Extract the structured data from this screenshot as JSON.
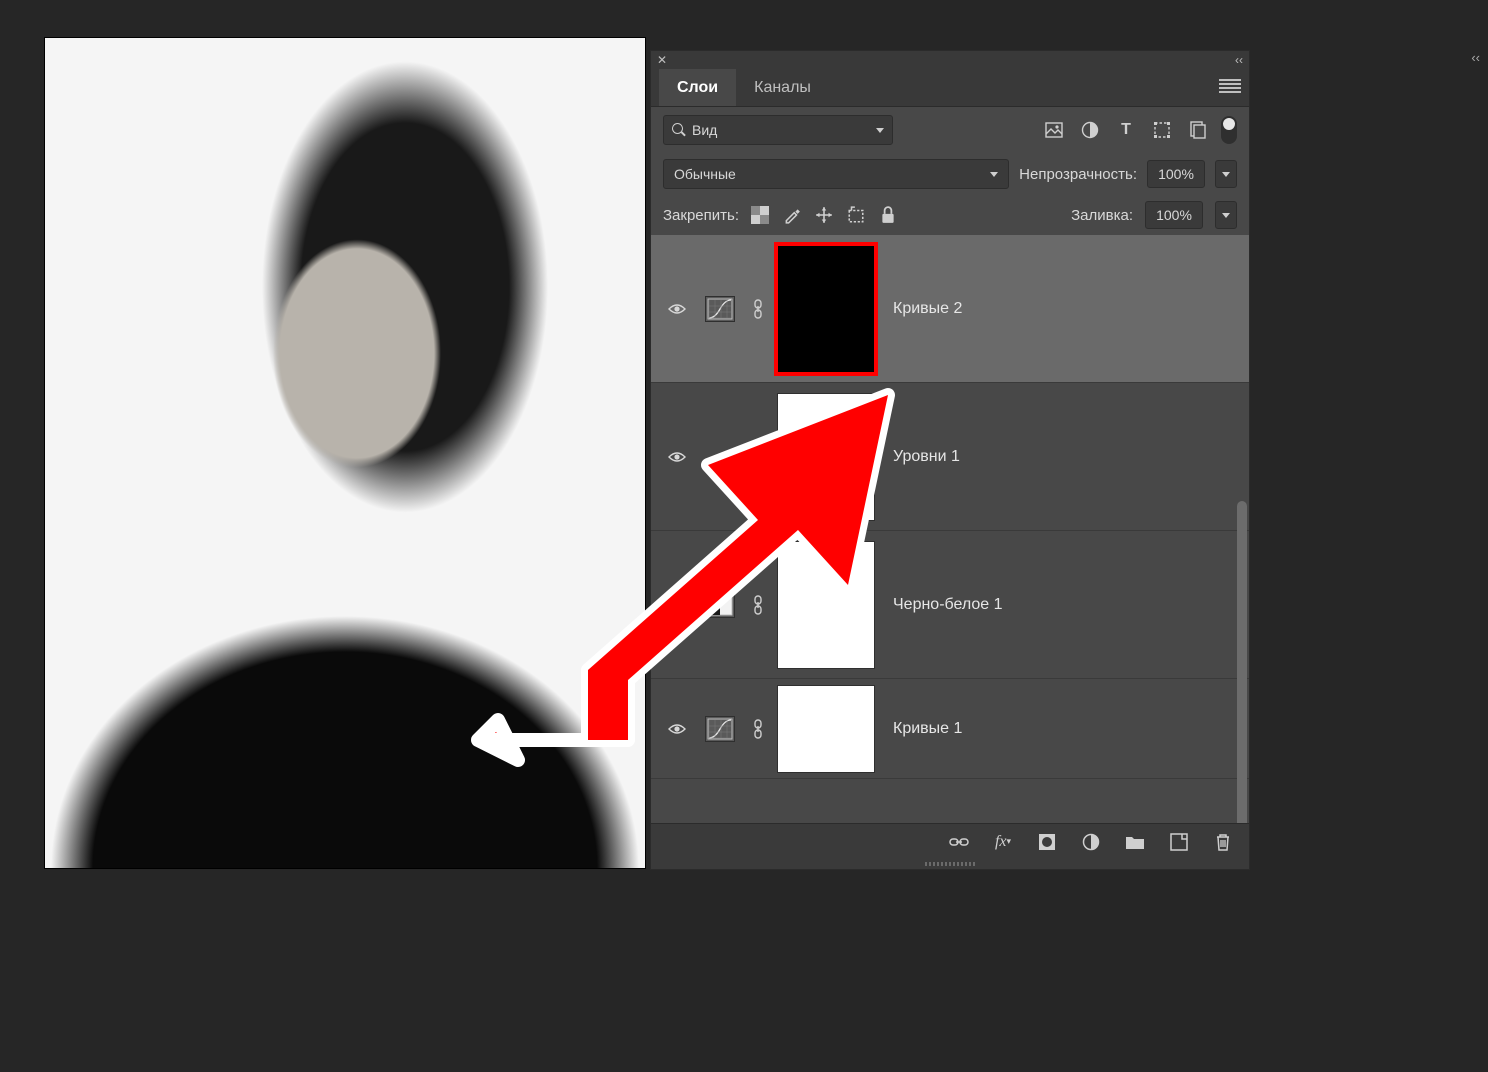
{
  "panel": {
    "tabs": {
      "layers": "Слои",
      "channels": "Каналы"
    },
    "search": {
      "label": "Вид"
    },
    "blend": {
      "mode": "Обычные",
      "opacity_label": "Непрозрачность:",
      "opacity_value": "100%"
    },
    "lock": {
      "label": "Закрепить:",
      "fill_label": "Заливка:",
      "fill_value": "100%"
    },
    "icons": {
      "close": "close-icon",
      "collapse": "collapse-icon",
      "menu": "menu-icon",
      "image": "image-icon",
      "adjust": "adjustment-icon",
      "type": "type-icon",
      "shape": "shape-icon",
      "smart": "smart-object-icon",
      "toggle": "panel-toggle",
      "lock_trans": "lock-transparency-icon",
      "lock_paint": "lock-paint-icon",
      "lock_move": "lock-position-icon",
      "lock_crop": "lock-artboard-icon",
      "lock_all": "lock-all-icon"
    }
  },
  "layers": [
    {
      "name": "Кривые 2",
      "type": "curves",
      "mask": "black",
      "selected": true,
      "mask_selected": true
    },
    {
      "name": "Уровни 1",
      "type": "levels",
      "mask": "white",
      "selected": false
    },
    {
      "name": "Черно-белое 1",
      "type": "bw",
      "mask": "white",
      "selected": false
    },
    {
      "name": "Кривые 1",
      "type": "curves",
      "mask": "white",
      "selected": false
    }
  ],
  "footer_icons": [
    "link-icon",
    "fx-icon",
    "mask-icon",
    "adjustment-icon",
    "group-icon",
    "new-layer-icon",
    "trash-icon"
  ]
}
